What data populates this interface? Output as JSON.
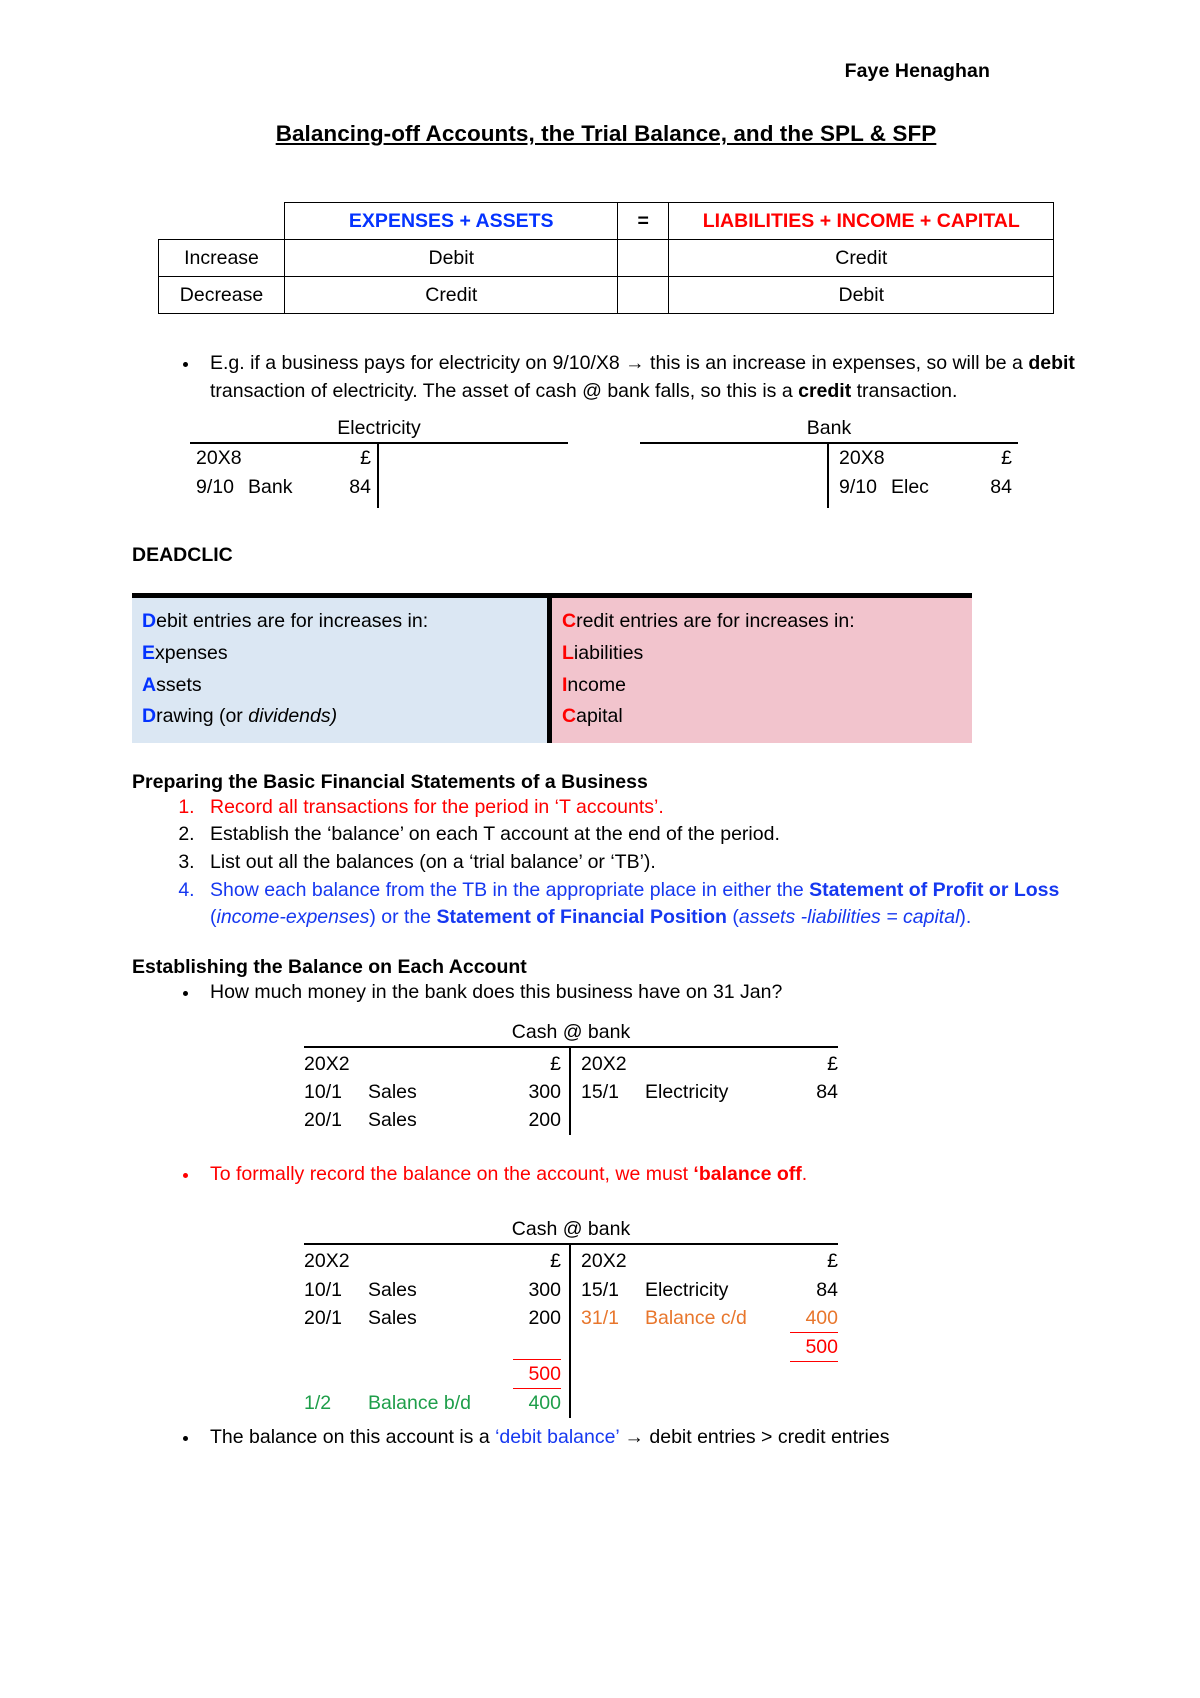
{
  "author": "Faye Henaghan",
  "title": "Balancing-off Accounts, the Trial Balance, and the SPL & SFP",
  "equation_table": {
    "header": {
      "left": "EXPENSES + ASSETS",
      "equals": "=",
      "right": "LIABILITIES + INCOME + CAPITAL",
      "left_color": "#0433ff",
      "right_color": "#ff0000"
    },
    "rows": [
      {
        "label": "Increase",
        "left": "Debit",
        "right": "Credit"
      },
      {
        "label": "Decrease",
        "left": "Credit",
        "right": "Debit"
      }
    ]
  },
  "example_bullet": {
    "part1": "E.g. if a business pays for electricity on 9/10/X8 → this is an increase in expenses, so will be a ",
    "bold1": "debit",
    "part2": " transaction of electricity. The asset of cash @ bank falls, so this is a ",
    "bold2": "credit",
    "part3": " transaction."
  },
  "t_accounts_simple": [
    {
      "title": "Electricity",
      "debit": [
        {
          "date": "20X8",
          "desc": "",
          "amount": "£"
        },
        {
          "date": "9/10",
          "desc": "Bank",
          "amount": "84"
        }
      ],
      "credit": []
    },
    {
      "title": "Bank",
      "debit": [],
      "credit": [
        {
          "date": "20X8",
          "desc": "",
          "amount": "£"
        },
        {
          "date": "9/10",
          "desc": "Elec",
          "amount": "84"
        }
      ]
    }
  ],
  "deadclic": {
    "label": "DEADCLIC",
    "left": {
      "bg": "#dbe7f3",
      "accent": "#0433ff",
      "lines": [
        {
          "cap": "D",
          "rest": "ebit entries are for increases in:",
          "italic": ""
        },
        {
          "cap": "E",
          "rest": "xpenses",
          "italic": ""
        },
        {
          "cap": "A",
          "rest": "ssets",
          "italic": ""
        },
        {
          "cap": "D",
          "rest": "rawing (or ",
          "italic": "dividends)"
        }
      ]
    },
    "right": {
      "bg": "#f2c4cd",
      "accent": "#ff0000",
      "lines": [
        {
          "cap": "C",
          "rest": "redit entries are for increases in:",
          "italic": ""
        },
        {
          "cap": "L",
          "rest": "iabilities",
          "italic": ""
        },
        {
          "cap": "I",
          "rest": "ncome",
          "italic": ""
        },
        {
          "cap": "C",
          "rest": "apital",
          "italic": ""
        }
      ]
    }
  },
  "preparing": {
    "heading": "Preparing the Basic Financial Statements of a Business",
    "item1": "Record all transactions for the period in ‘T accounts’.",
    "item2": "Establish the ‘balance’ on each T account at the end of the period.",
    "item3": "List out all the balances (on a ‘trial balance’ or ‘TB’).",
    "item4": {
      "p1": "Show each balance from the TB in the appropriate place in either the ",
      "b1": "Statement of Profit or Loss",
      "p2": " (",
      "i1": "income-expenses",
      "p3": ") or the ",
      "b2": "Statement of Financial Position",
      "p4": " (",
      "i2": "assets -liabilities = capital",
      "p5": ")."
    }
  },
  "establishing": {
    "heading": "Establishing the Balance on Each Account",
    "question": "How much money in the bank does this business have on 31 Jan?"
  },
  "cash_account_1": {
    "title": "Cash @ bank",
    "debit": [
      {
        "date": "20X2",
        "desc": "",
        "amount": "£"
      },
      {
        "date": "10/1",
        "desc": "Sales",
        "amount": "300"
      },
      {
        "date": "20/1",
        "desc": "Sales",
        "amount": "200"
      }
    ],
    "credit": [
      {
        "date": "20X2",
        "desc": "",
        "amount": "£"
      },
      {
        "date": "15/1",
        "desc": "Electricity",
        "amount": "84"
      }
    ]
  },
  "balance_off_bullet": {
    "p1": "To formally record the balance on the account, we must ",
    "b1": "‘balance off",
    "p2": ".",
    "color": "#ff0000"
  },
  "cash_account_2": {
    "title": "Cash @ bank",
    "debit": [
      {
        "date": "20X2",
        "desc": "",
        "amount": "£",
        "color": "black"
      },
      {
        "date": "10/1",
        "desc": "Sales",
        "amount": "300",
        "color": "black"
      },
      {
        "date": "20/1",
        "desc": "Sales",
        "amount": "200",
        "color": "black"
      },
      {
        "date": "",
        "desc": "",
        "amount": "",
        "color": "black"
      },
      {
        "date": "",
        "desc": "",
        "amount": "500",
        "color": "red",
        "total": true
      },
      {
        "date": "1/2",
        "desc": "Balance b/d",
        "amount": "400",
        "color": "green"
      }
    ],
    "credit": [
      {
        "date": "20X2",
        "desc": "",
        "amount": "£",
        "color": "black"
      },
      {
        "date": "15/1",
        "desc": "Electricity",
        "amount": "84",
        "color": "black"
      },
      {
        "date": "31/1",
        "desc": "Balance c/d",
        "amount": "400",
        "color": "orange"
      },
      {
        "date": "",
        "desc": "",
        "amount": "500",
        "color": "red",
        "total": true
      }
    ],
    "colors": {
      "red": "#ff0000",
      "green": "#1e9e4a",
      "orange": "#e8762c"
    }
  },
  "final_bullet": {
    "p1": "The balance on this account is a ",
    "blue": "‘debit balance’",
    "p2": " → debit entries > credit entries"
  }
}
